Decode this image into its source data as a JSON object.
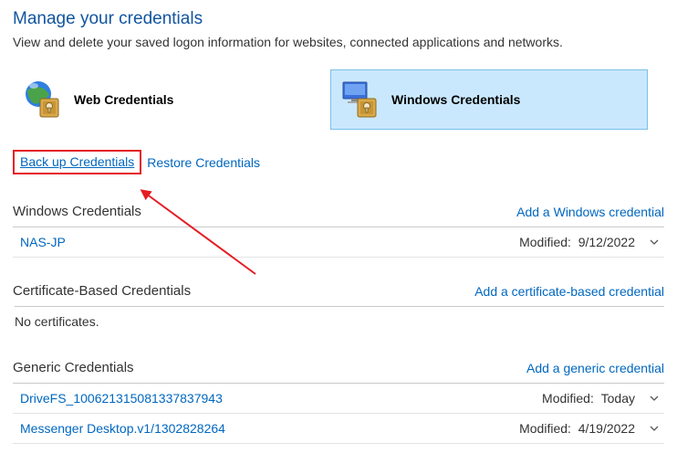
{
  "header": {
    "title": "Manage your credentials",
    "description": "View and delete your saved logon information for websites, connected applications and networks."
  },
  "credential_types": [
    {
      "label": "Web Credentials",
      "selected": false
    },
    {
      "label": "Windows Credentials",
      "selected": true
    }
  ],
  "actions": {
    "backup": "Back up Credentials",
    "restore": "Restore Credentials"
  },
  "sections": {
    "windows": {
      "title": "Windows Credentials",
      "add_label": "Add a Windows credential",
      "items": [
        {
          "name": "NAS-JP",
          "modified_label": "Modified:",
          "modified_value": "9/12/2022"
        }
      ]
    },
    "certificate": {
      "title": "Certificate-Based Credentials",
      "add_label": "Add a certificate-based credential",
      "empty_text": "No certificates."
    },
    "generic": {
      "title": "Generic Credentials",
      "add_label": "Add a generic credential",
      "items": [
        {
          "name": "DriveFS_100621315081337837943",
          "modified_label": "Modified:",
          "modified_value": "Today"
        },
        {
          "name": "Messenger Desktop.v1/1302828264",
          "modified_label": "Modified:",
          "modified_value": "4/19/2022"
        }
      ]
    }
  }
}
